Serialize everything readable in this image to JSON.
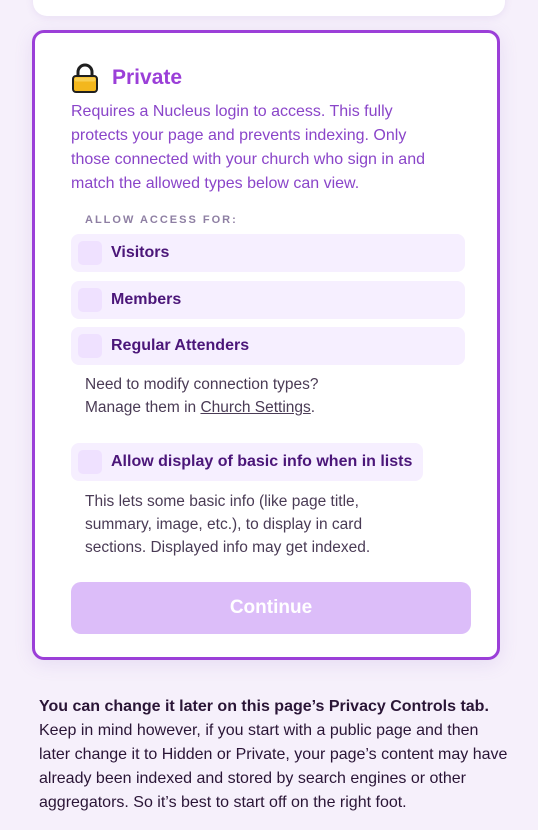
{
  "private_option": {
    "title": "Private",
    "description": "Requires a Nucleus login to access. This fully protects your page and prevents indexing. Only those connected with your church who sign in and match the allowed types below can view.",
    "allow_access_label": "ALLOW ACCESS FOR:",
    "access_types": [
      {
        "label": "Visitors",
        "checked": false
      },
      {
        "label": "Members",
        "checked": false
      },
      {
        "label": "Regular Attenders",
        "checked": false
      }
    ],
    "modify_text_line1": "Need to modify connection types?",
    "modify_text_prefix": "Manage them in ",
    "modify_link": "Church Settings",
    "modify_text_suffix": ".",
    "basic_info_option": {
      "label": "Allow display of basic info when in lists",
      "checked": false
    },
    "basic_info_help": "This lets some basic info (like page title, summary, image, etc.), to display in card sections. Displayed info may get indexed.",
    "continue_label": "Continue"
  },
  "footer": {
    "bold_text": "You can change it later on this page’s Privacy Controls tab.",
    "body_text": " Keep in mind however, if you start with a public page and then later change it to Hidden or Private, your page’s content may have already been indexed and stored by search engines or other aggregators. So it’s best to start off on the right foot."
  },
  "colors": {
    "accent": "#9b3fd8",
    "button_disabled": "#dcbdf9",
    "lock_body": "#f3b71d"
  }
}
